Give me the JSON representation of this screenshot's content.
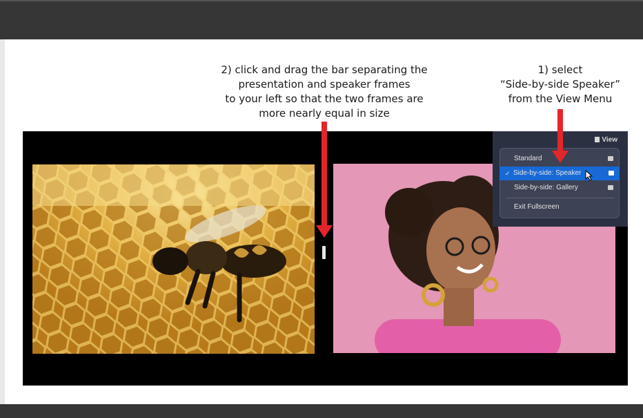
{
  "instructions": {
    "step2": [
      "2) click and drag the bar separating the",
      "presentation and speaker frames",
      "to your left so that the two frames are",
      "more nearly equal in size"
    ],
    "step1": [
      "1) select",
      "“Side-by-side Speaker”",
      "from the View Menu"
    ]
  },
  "view_button": {
    "label": "View",
    "icon": "layout-icon"
  },
  "view_menu": {
    "items": [
      {
        "label": "Standard",
        "icon": "standard-layout-icon",
        "checked": false
      },
      {
        "label": "Side-by-side: Speaker",
        "icon": "speaker-layout-icon",
        "checked": true,
        "checkmark": "✓"
      },
      {
        "label": "Side-by-side: Gallery",
        "icon": "gallery-layout-icon",
        "checked": false
      },
      {
        "label": "Exit Fullscreen",
        "checked": false
      }
    ]
  },
  "colors": {
    "arrow": "#e3262b",
    "selected": "#1769d6",
    "stage": "#000000",
    "chrome": "#363636"
  }
}
